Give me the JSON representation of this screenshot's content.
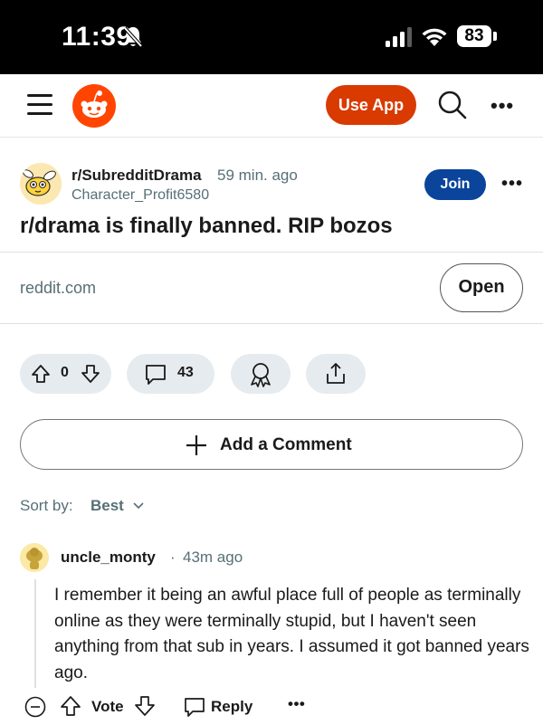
{
  "status_bar": {
    "time": "11:39",
    "battery": "83"
  },
  "topnav": {
    "use_app_label": "Use App",
    "more": "•••"
  },
  "post": {
    "subreddit": "r/SubredditDrama",
    "time": "59 min. ago",
    "author": "Character_Profit6580",
    "join_label": "Join",
    "more": "•••",
    "title": "r/drama is finally banned. RIP bozos",
    "link_domain": "reddit.com",
    "open_label": "Open",
    "score": "0",
    "comment_count": "43"
  },
  "add_comment": {
    "label": "Add a Comment"
  },
  "sort": {
    "label": "Sort by:",
    "value": "Best"
  },
  "comments": [
    {
      "author": "uncle_monty",
      "separator": "·",
      "time": "43m ago",
      "body": "I remember it being an awful place full of people as terminally online as they were terminally stupid, but I haven't seen anything from that sub in years. I assumed it got banned years ago.",
      "vote_label": "Vote",
      "reply_label": "Reply",
      "more": "•••"
    }
  ],
  "colors": {
    "brand_orange": "#d93a00",
    "join_blue": "#0a449b",
    "pill_bg": "#e5ebee",
    "meta_gray": "#576f76"
  }
}
